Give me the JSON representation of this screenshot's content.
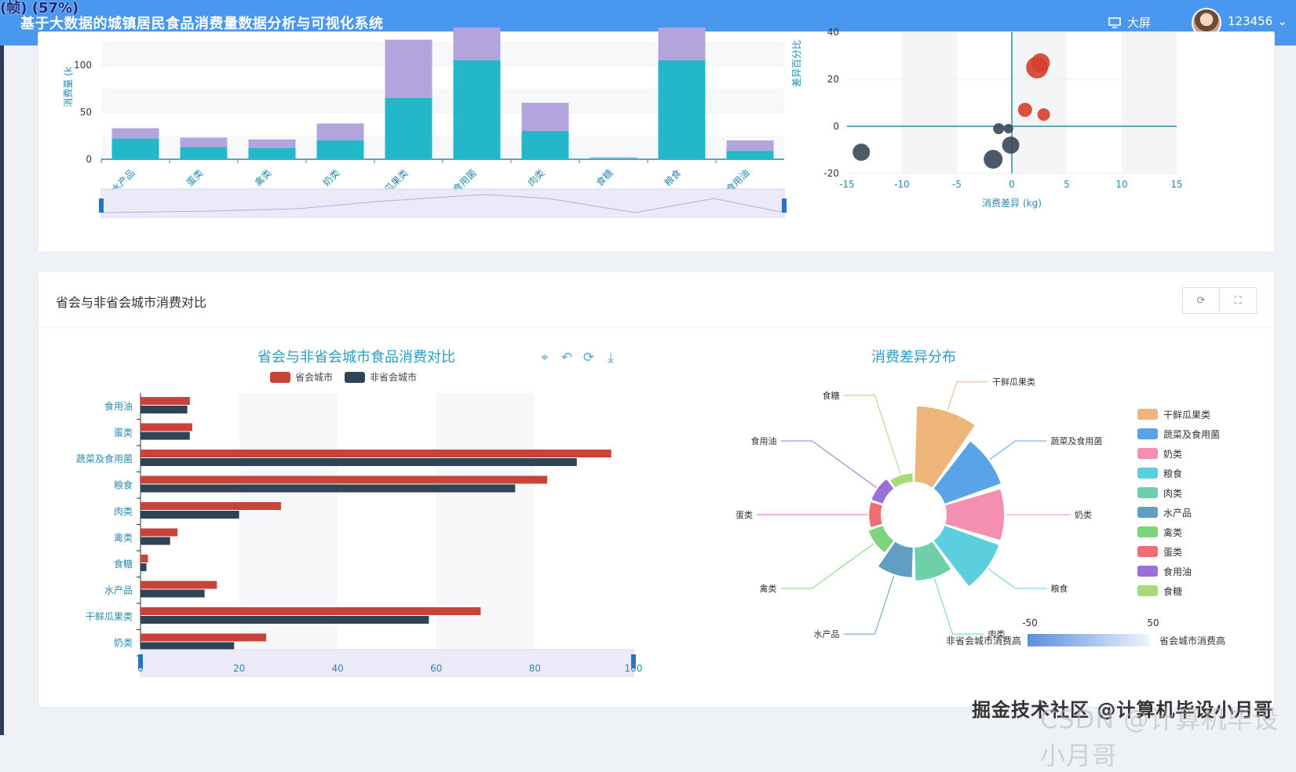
{
  "header": {
    "recording_overlay": "(帧) (57%)",
    "title": "基于大数据的城镇居民食品消费量数据分析与可视化系统",
    "bigscreen_label": "大屏",
    "username": "123456"
  },
  "top_section": {
    "bar_ylabel": "消费量 (k",
    "scatter_xlabel": "消费差异 (kg)",
    "scatter_ylabel": "差异百分比"
  },
  "section2": {
    "title": "省会与非省会城市消费对比",
    "refresh_icon": "refresh-icon",
    "fullscreen_icon": "fullscreen-icon"
  },
  "chart_data": [
    {
      "type": "bar",
      "stacked": true,
      "ylabel": "消费量 (k",
      "categories": [
        "水产品",
        "蛋类",
        "禽类",
        "奶类",
        "干鲜瓜果类",
        "蔬菜及食用菌",
        "肉类",
        "食糖",
        "粮食",
        "食用油"
      ],
      "series": [
        {
          "values": [
            22,
            13,
            12,
            20,
            65,
            105,
            30,
            1,
            105,
            9
          ],
          "color": "#22b8c9"
        },
        {
          "values": [
            11,
            10,
            9,
            18,
            62,
            35,
            30,
            1,
            35,
            11
          ],
          "color": "#b3a4dd"
        }
      ],
      "yticks": [
        0,
        50,
        100
      ],
      "ylim": [
        0,
        135
      ]
    },
    {
      "type": "scatter",
      "xlabel": "消费差异 (kg)",
      "ylabel": "差异百分比",
      "xlim": [
        -15,
        15
      ],
      "ylim": [
        -20,
        60
      ],
      "xticks": [
        -15,
        -10,
        -5,
        0,
        5,
        10,
        15
      ],
      "yticks": [
        -20,
        0,
        20,
        40
      ],
      "points": [
        {
          "x": -13.7,
          "y": -11,
          "color": "#3b4756",
          "r": 11
        },
        {
          "x": -1.7,
          "y": -14,
          "color": "#3b4756",
          "r": 12
        },
        {
          "x": -0.1,
          "y": -8,
          "color": "#3b4756",
          "r": 11
        },
        {
          "x": -1.2,
          "y": -1,
          "color": "#3b4756",
          "r": 7
        },
        {
          "x": -0.3,
          "y": -1,
          "color": "#3b4756",
          "r": 6
        },
        {
          "x": 2.3,
          "y": 25,
          "color": "#d63f2e",
          "r": 14
        },
        {
          "x": 2.6,
          "y": 27,
          "color": "#d63f2e",
          "r": 12
        },
        {
          "x": 1.2,
          "y": 7,
          "color": "#d63f2e",
          "r": 9
        },
        {
          "x": 2.9,
          "y": 5,
          "color": "#d63f2e",
          "r": 8
        }
      ]
    },
    {
      "type": "bar",
      "orientation": "horizontal",
      "title": "省会与非省会城市食品消费对比",
      "legend": [
        "省会城市",
        "非省会城市"
      ],
      "categories": [
        "食用油",
        "蛋类",
        "蔬菜及食用菌",
        "粮食",
        "肉类",
        "禽类",
        "食糖",
        "水产品",
        "干鲜瓜果类",
        "奶类"
      ],
      "series": [
        {
          "name": "省会城市",
          "color": "#c8433a",
          "values": [
            10,
            10.5,
            95.5,
            82.5,
            28.5,
            7.5,
            1.5,
            15.5,
            69,
            25.5
          ]
        },
        {
          "name": "非省会城市",
          "color": "#2f4555",
          "values": [
            9.5,
            10,
            88.5,
            76,
            20,
            6,
            1.2,
            13,
            58.5,
            19
          ]
        }
      ],
      "xticks": [
        0,
        20,
        40,
        60,
        80,
        100
      ],
      "xlim": [
        0,
        100
      ]
    },
    {
      "type": "pie",
      "subtype": "rose",
      "title": "消费差异分布",
      "slices": [
        {
          "name": "干鲜瓜果类",
          "value": 65,
          "color": "#edb57a"
        },
        {
          "name": "蔬菜及食用菌",
          "value": 50,
          "color": "#5ba3e8"
        },
        {
          "name": "奶类",
          "value": 48,
          "color": "#f48fb1"
        },
        {
          "name": "粮食",
          "value": 48,
          "color": "#5ccfdf"
        },
        {
          "name": "肉类",
          "value": 25,
          "color": "#6dd0a8"
        },
        {
          "name": "水产品",
          "value": 22,
          "color": "#5f9fc2"
        },
        {
          "name": "禽类",
          "value": 8,
          "color": "#7dd57b"
        },
        {
          "name": "蛋类",
          "value": 5,
          "color": "#f06d74"
        },
        {
          "name": "食用油",
          "value": 5,
          "color": "#9b6fd8"
        },
        {
          "name": "食糖",
          "value": 2,
          "color": "#a8da7a"
        }
      ],
      "visualmap": {
        "min_label": "-50",
        "max_label": "50",
        "low_text": "非省会城市消费高",
        "high_text": "省会城市消费高"
      }
    }
  ],
  "chart_toolbox": [
    "zoom-icon",
    "zoom-reset-icon",
    "restore-icon",
    "download-icon"
  ],
  "watermark": {
    "text": "掘金技术社区 @计算机毕设小月哥",
    "text2": "CSDN @计算机毕设小月哥"
  }
}
